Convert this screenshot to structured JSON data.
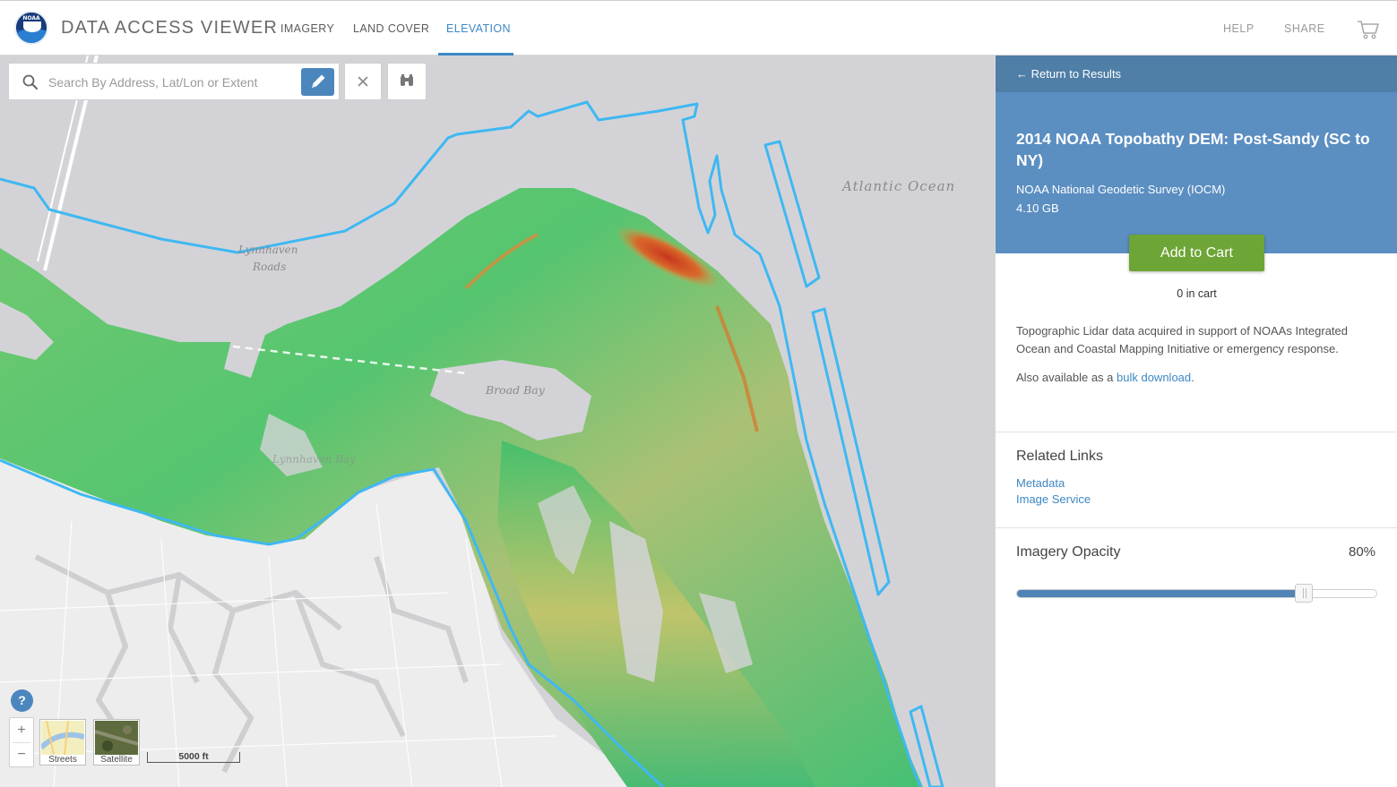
{
  "header": {
    "app_title": "DATA ACCESS VIEWER",
    "logo_text": "NOAA",
    "tabs": [
      {
        "label": "IMAGERY",
        "active": false
      },
      {
        "label": "LAND COVER",
        "active": false
      },
      {
        "label": "ELEVATION",
        "active": true
      }
    ],
    "help_label": "HELP",
    "share_label": "SHARE",
    "cart_icon": "cart-icon"
  },
  "map": {
    "search_placeholder": "Search By Address, Lat/Lon or Extent",
    "labels": {
      "ocean": "Atlantic Ocean",
      "roads_line1": "Lynnhaven",
      "roads_line2": "Roads",
      "bay": "Broad Bay",
      "lynnhaven_bay": "Lynnhaven Bay"
    },
    "help_label": "?",
    "zoom_in_label": "+",
    "zoom_out_label": "−",
    "basemaps": [
      {
        "label": "Streets"
      },
      {
        "label": "Satellite"
      }
    ],
    "scale_label": "5000 ft",
    "icons": [
      "search-icon",
      "pencil-icon",
      "close-icon",
      "binoculars-icon"
    ]
  },
  "panel": {
    "return_label": "Return to Results",
    "dataset_title": "2014 NOAA Topobathy DEM: Post-Sandy (SC to NY)",
    "source": "NOAA National Geodetic Survey (IOCM)",
    "size": "4.10 GB",
    "add_to_cart_label": "Add to Cart",
    "cart_count": "0 in cart",
    "description": "Topographic Lidar data acquired in support of NOAAs Integrated Ocean and Coastal Mapping Initiative or emergency response.",
    "bulk_prefix": "Also available as a ",
    "bulk_link": "bulk download",
    "bulk_suffix": ".",
    "related_links_title": "Related Links",
    "related_links": [
      "Metadata",
      "Image Service"
    ],
    "opacity_title": "Imagery Opacity",
    "opacity_value": "80%",
    "opacity_fraction": 0.8
  },
  "colors": {
    "accent": "#3d88c3",
    "panel_header": "#4f7ea7",
    "panel_hero": "#5b8ec1",
    "cart_button": "#6da536",
    "boundary": "#3fb8f2"
  }
}
